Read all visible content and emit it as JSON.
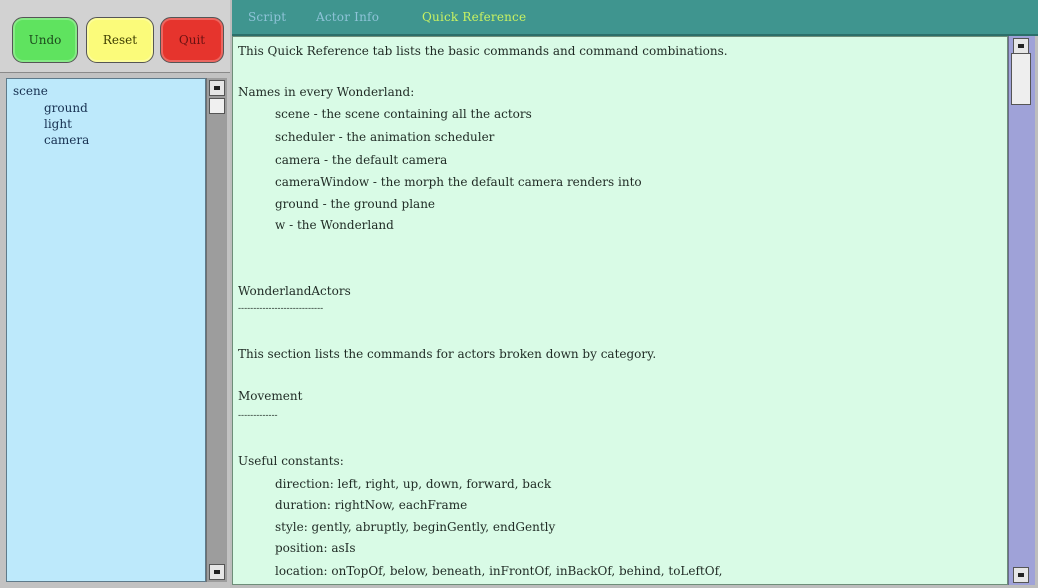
{
  "toolbar": {
    "undo_label": "Undo",
    "reset_label": "Reset",
    "quit_label": "Quit"
  },
  "colors": {
    "undo": "#5fe35f",
    "reset": "#fbfb7a",
    "quit": "#e6342d",
    "tabbar": "#3f958f",
    "text_bg": "#d9fbe6",
    "tree_bg": "#bde9fb"
  },
  "tabs": {
    "script": "Script",
    "actor_info": "Actor Info",
    "quick_reference": "Quick Reference"
  },
  "tree": {
    "root": "scene",
    "children": [
      "ground",
      "light",
      "camera"
    ]
  },
  "reference": {
    "intro": "This Quick Reference tab lists the basic commands and command combinations.",
    "names_heading": "Names in every Wonderland:",
    "names": [
      "scene - the scene containing all the actors",
      "scheduler - the animation scheduler",
      "camera - the default camera",
      "cameraWindow - the morph the default camera renders into",
      "ground - the ground plane",
      "w - the Wonderland"
    ],
    "section_heading": "WonderlandActors",
    "section_rule": "----------------------------",
    "section_intro": "This section lists the commands for actors broken down by category.",
    "movement_heading": "Movement",
    "movement_rule": "-------------",
    "constants_heading": "Useful constants:",
    "constants": [
      "direction: left, right, up, down, forward, back",
      "duration: rightNow, eachFrame",
      "style: gently, abruptly, beginGently, endGently",
      "position: asIs",
      "location: onTopOf, below, beneath, inFrontOf, inBackOf, behind, toLeftOf,"
    ]
  }
}
